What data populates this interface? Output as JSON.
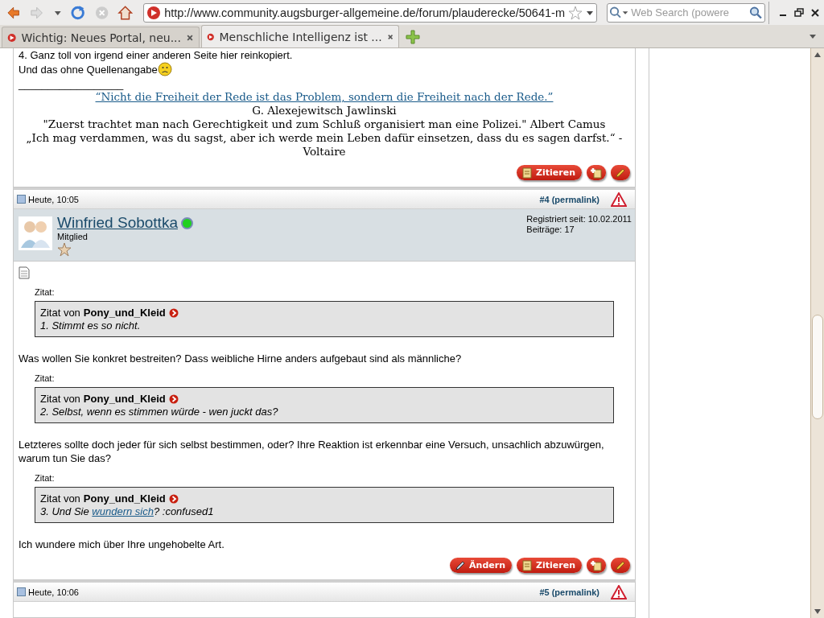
{
  "browser": {
    "url": "http://www.community.augsburger-allgemeine.de/forum/plauderecke/50641-m",
    "search_placeholder": "Web Search (powere",
    "tabs": [
      {
        "title": "Wichtig: Neues Portal, neu...",
        "selected": false
      },
      {
        "title": "Menschliche Intelligenz ist ...",
        "selected": true
      }
    ]
  },
  "previous_post": {
    "lines": [
      "4. Ganz toll von irgend einer anderen Seite hier reinkopiert.",
      "Und das ohne Quellenangabe"
    ],
    "signature": {
      "separator": "__________________",
      "link": "“Nicht die Freiheit der Rede ist das Problem, sondern die Freiheit nach der Rede.”",
      "lines": [
        "G. Alexejewitsch Jawlinski",
        "\"Zuerst trachtet man nach Gerechtigkeit und zum Schluß organisiert man eine Polizei.\" Albert Camus",
        "„Ich mag verdammen, was du sagst, aber ich werde mein Leben dafür einsetzen, dass du es sagen darfst.“ - Voltaire"
      ]
    },
    "buttons": [
      {
        "kind": "quote",
        "label": "Zitieren"
      },
      {
        "kind": "multiquote"
      },
      {
        "kind": "edit"
      }
    ]
  },
  "post": {
    "date": "Heute, 10:05",
    "permalink": "#4 (permalink)",
    "author": {
      "name": "Winfried Sobottka",
      "online": true,
      "rank": "Mitglied",
      "registered": "Registriert seit: 10.02.2011",
      "posts": "Beiträge: 17"
    },
    "content": [
      {
        "kind": "quote",
        "label": "Zitat:",
        "prefix": "Zitat von",
        "user": "Pony_und_Kleid",
        "parts": [
          {
            "text": "1. Stimmt es so nicht."
          }
        ]
      },
      {
        "kind": "paragraph",
        "text": "Was wollen Sie konkret bestreiten? Dass weibliche Hirne anders aufgebaut sind als männliche?"
      },
      {
        "kind": "quote",
        "label": "Zitat:",
        "prefix": "Zitat von",
        "user": "Pony_und_Kleid",
        "parts": [
          {
            "text": "2. Selbst, wenn es stimmen würde - wen juckt das?"
          }
        ]
      },
      {
        "kind": "paragraph",
        "text": "Letzteres sollte doch jeder für sich selbst bestimmen, oder? Ihre Reaktion ist erkennbar eine Versuch, unsachlich abzuwürgen, warum tun Sie das?"
      },
      {
        "kind": "quote",
        "label": "Zitat:",
        "prefix": "Zitat von",
        "user": "Pony_und_Kleid",
        "parts": [
          {
            "text": "3. Und Sie "
          },
          {
            "text": "wundern sich",
            "link": true
          },
          {
            "text": "? :confused1"
          }
        ]
      },
      {
        "kind": "paragraph",
        "text": "Ich wundere mich über Ihre ungehobelte Art."
      }
    ],
    "buttons": [
      {
        "kind": "edit_post",
        "label": "Ändern"
      },
      {
        "kind": "quote",
        "label": "Zitieren"
      },
      {
        "kind": "multiquote"
      },
      {
        "kind": "edit"
      }
    ]
  },
  "next_post": {
    "date": "Heute, 10:06",
    "permalink": "#5 (permalink)"
  }
}
